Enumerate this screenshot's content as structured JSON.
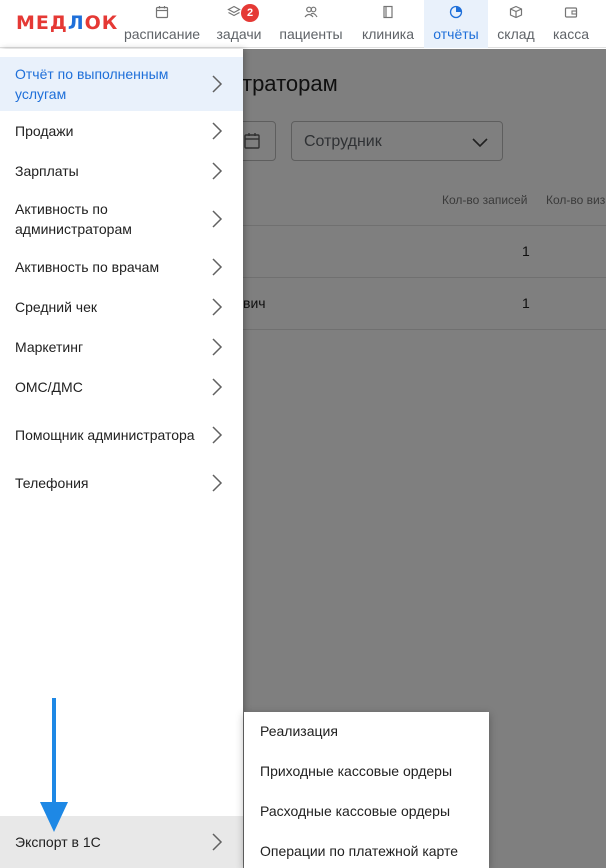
{
  "app": {
    "logo_text_red_1": "МЕД",
    "logo_text_blue": "Л",
    "logo_text_red_2": "ОК"
  },
  "nav": {
    "items": [
      {
        "label": "расписание",
        "icon": "calendar-icon"
      },
      {
        "label": "задачи",
        "icon": "layers-icon",
        "badge": "2"
      },
      {
        "label": "пациенты",
        "icon": "people-icon"
      },
      {
        "label": "клиника",
        "icon": "book-icon"
      },
      {
        "label": "отчёты",
        "icon": "chart-pie-icon",
        "active": true
      },
      {
        "label": "склад",
        "icon": "box-icon"
      },
      {
        "label": "касса",
        "icon": "wallet-icon"
      }
    ]
  },
  "page": {
    "title_fragment": "траторам",
    "employee_select": "Сотрудник",
    "columns": [
      "Кол-во записей",
      "Кол-во виз"
    ],
    "rows": [
      {
        "name_fragment": "",
        "records": "1"
      },
      {
        "name_fragment": "вич",
        "records": "1"
      }
    ]
  },
  "drawer": {
    "items": [
      {
        "label": "Отчёт по выполненным услугам",
        "selected": true
      },
      {
        "label": "Продажи"
      },
      {
        "label": "Зарплаты"
      },
      {
        "label": "Активность по администраторам"
      },
      {
        "label": "Активность по врачам"
      },
      {
        "label": "Средний чек"
      },
      {
        "label": "Маркетинг"
      },
      {
        "label": "ОМС/ДМС"
      },
      {
        "label": "Помощник администратора"
      },
      {
        "label": "Телефония"
      }
    ],
    "export_item": "Экспорт в 1С"
  },
  "submenu": {
    "items": [
      "Реализация",
      "Приходные кассовые ордеры",
      "Расходные кассовые ордеры",
      "Операции по платежной карте"
    ]
  },
  "colors": {
    "brand_red": "#e53935",
    "brand_blue": "#1e6fd9",
    "annotation_arrow": "#1e88e5"
  }
}
